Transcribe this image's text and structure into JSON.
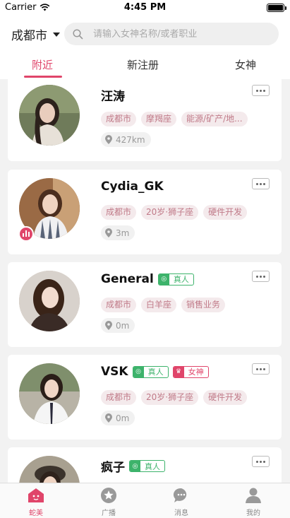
{
  "status": {
    "carrier": "Carrier",
    "time": "4:45 PM"
  },
  "header": {
    "city": "成都市",
    "search_placeholder": "请输入女神名称/或者职业",
    "tabs": [
      "附近",
      "新注册",
      "女神"
    ]
  },
  "cards": [
    {
      "name": "汪涛",
      "tags": [
        "成都市",
        "摩羯座",
        "能源/矿产/地..."
      ],
      "distance": "427km"
    },
    {
      "name": "Cydia_GK",
      "tags": [
        "成都市",
        "20岁·狮子座",
        "硬件开发"
      ],
      "distance": "3m"
    },
    {
      "name": "General",
      "badges": {
        "real": "真人"
      },
      "tags": [
        "成都市",
        "白羊座",
        "销售业务"
      ],
      "distance": "0m"
    },
    {
      "name": "VSK",
      "badges": {
        "real": "真人",
        "goddess": "女神"
      },
      "tags": [
        "成都市",
        "20岁·狮子座",
        "硬件开发"
      ],
      "distance": "0m"
    },
    {
      "name": "疯子",
      "badges": {
        "real": "真人"
      }
    }
  ],
  "tabbar": [
    "蛇美",
    "广播",
    "消息",
    "我的"
  ],
  "colors": {
    "accent": "#e0456a",
    "real_badge": "#3db36b"
  }
}
